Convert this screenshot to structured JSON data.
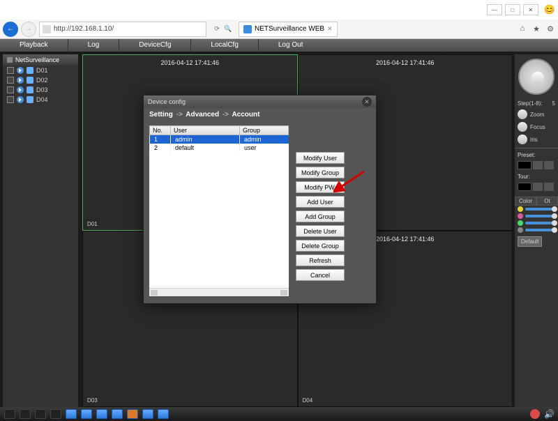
{
  "browser": {
    "url": "http://192.168.1.10/",
    "tab_title": "NETSurveillance WEB"
  },
  "menu": {
    "items": [
      "Playback",
      "Log",
      "DeviceCfg",
      "LocalCfg",
      "Log Out"
    ]
  },
  "left": {
    "title": "NetSurveillance",
    "channels": [
      "D01",
      "D02",
      "D03",
      "D04"
    ]
  },
  "cells": {
    "tl": {
      "ts": "2016-04-12 17:41:46",
      "name": "D01"
    },
    "tr": {
      "ts": "2016-04-12 17:41:46",
      "name": ""
    },
    "bl": {
      "ts": "",
      "name": "D03"
    },
    "br": {
      "ts": "2016-04-12 17:41:46",
      "name": "D04"
    }
  },
  "right": {
    "step_label": "Step(1-8):",
    "step_value": "5",
    "zoom": "Zoom",
    "focus": "Focus",
    "iris": "Iris",
    "preset": "Preset:",
    "tour": "Tour:",
    "tab_color": "Color",
    "tab_other": "Ot",
    "default": "Default"
  },
  "dialog": {
    "title": "Device config",
    "crumb": [
      "Setting",
      "Advanced",
      "Account"
    ],
    "table": {
      "headers": [
        "No.",
        "User",
        "Group"
      ],
      "rows": [
        {
          "no": "1",
          "user": "admin",
          "group": "admin",
          "selected": true
        },
        {
          "no": "2",
          "user": "default",
          "group": "user",
          "selected": false
        }
      ]
    },
    "buttons": [
      "Modify User",
      "Modify Group",
      "Modify PW.",
      "Add User",
      "Add Group",
      "Delete User",
      "Delete Group",
      "Refresh",
      "Cancel"
    ]
  }
}
